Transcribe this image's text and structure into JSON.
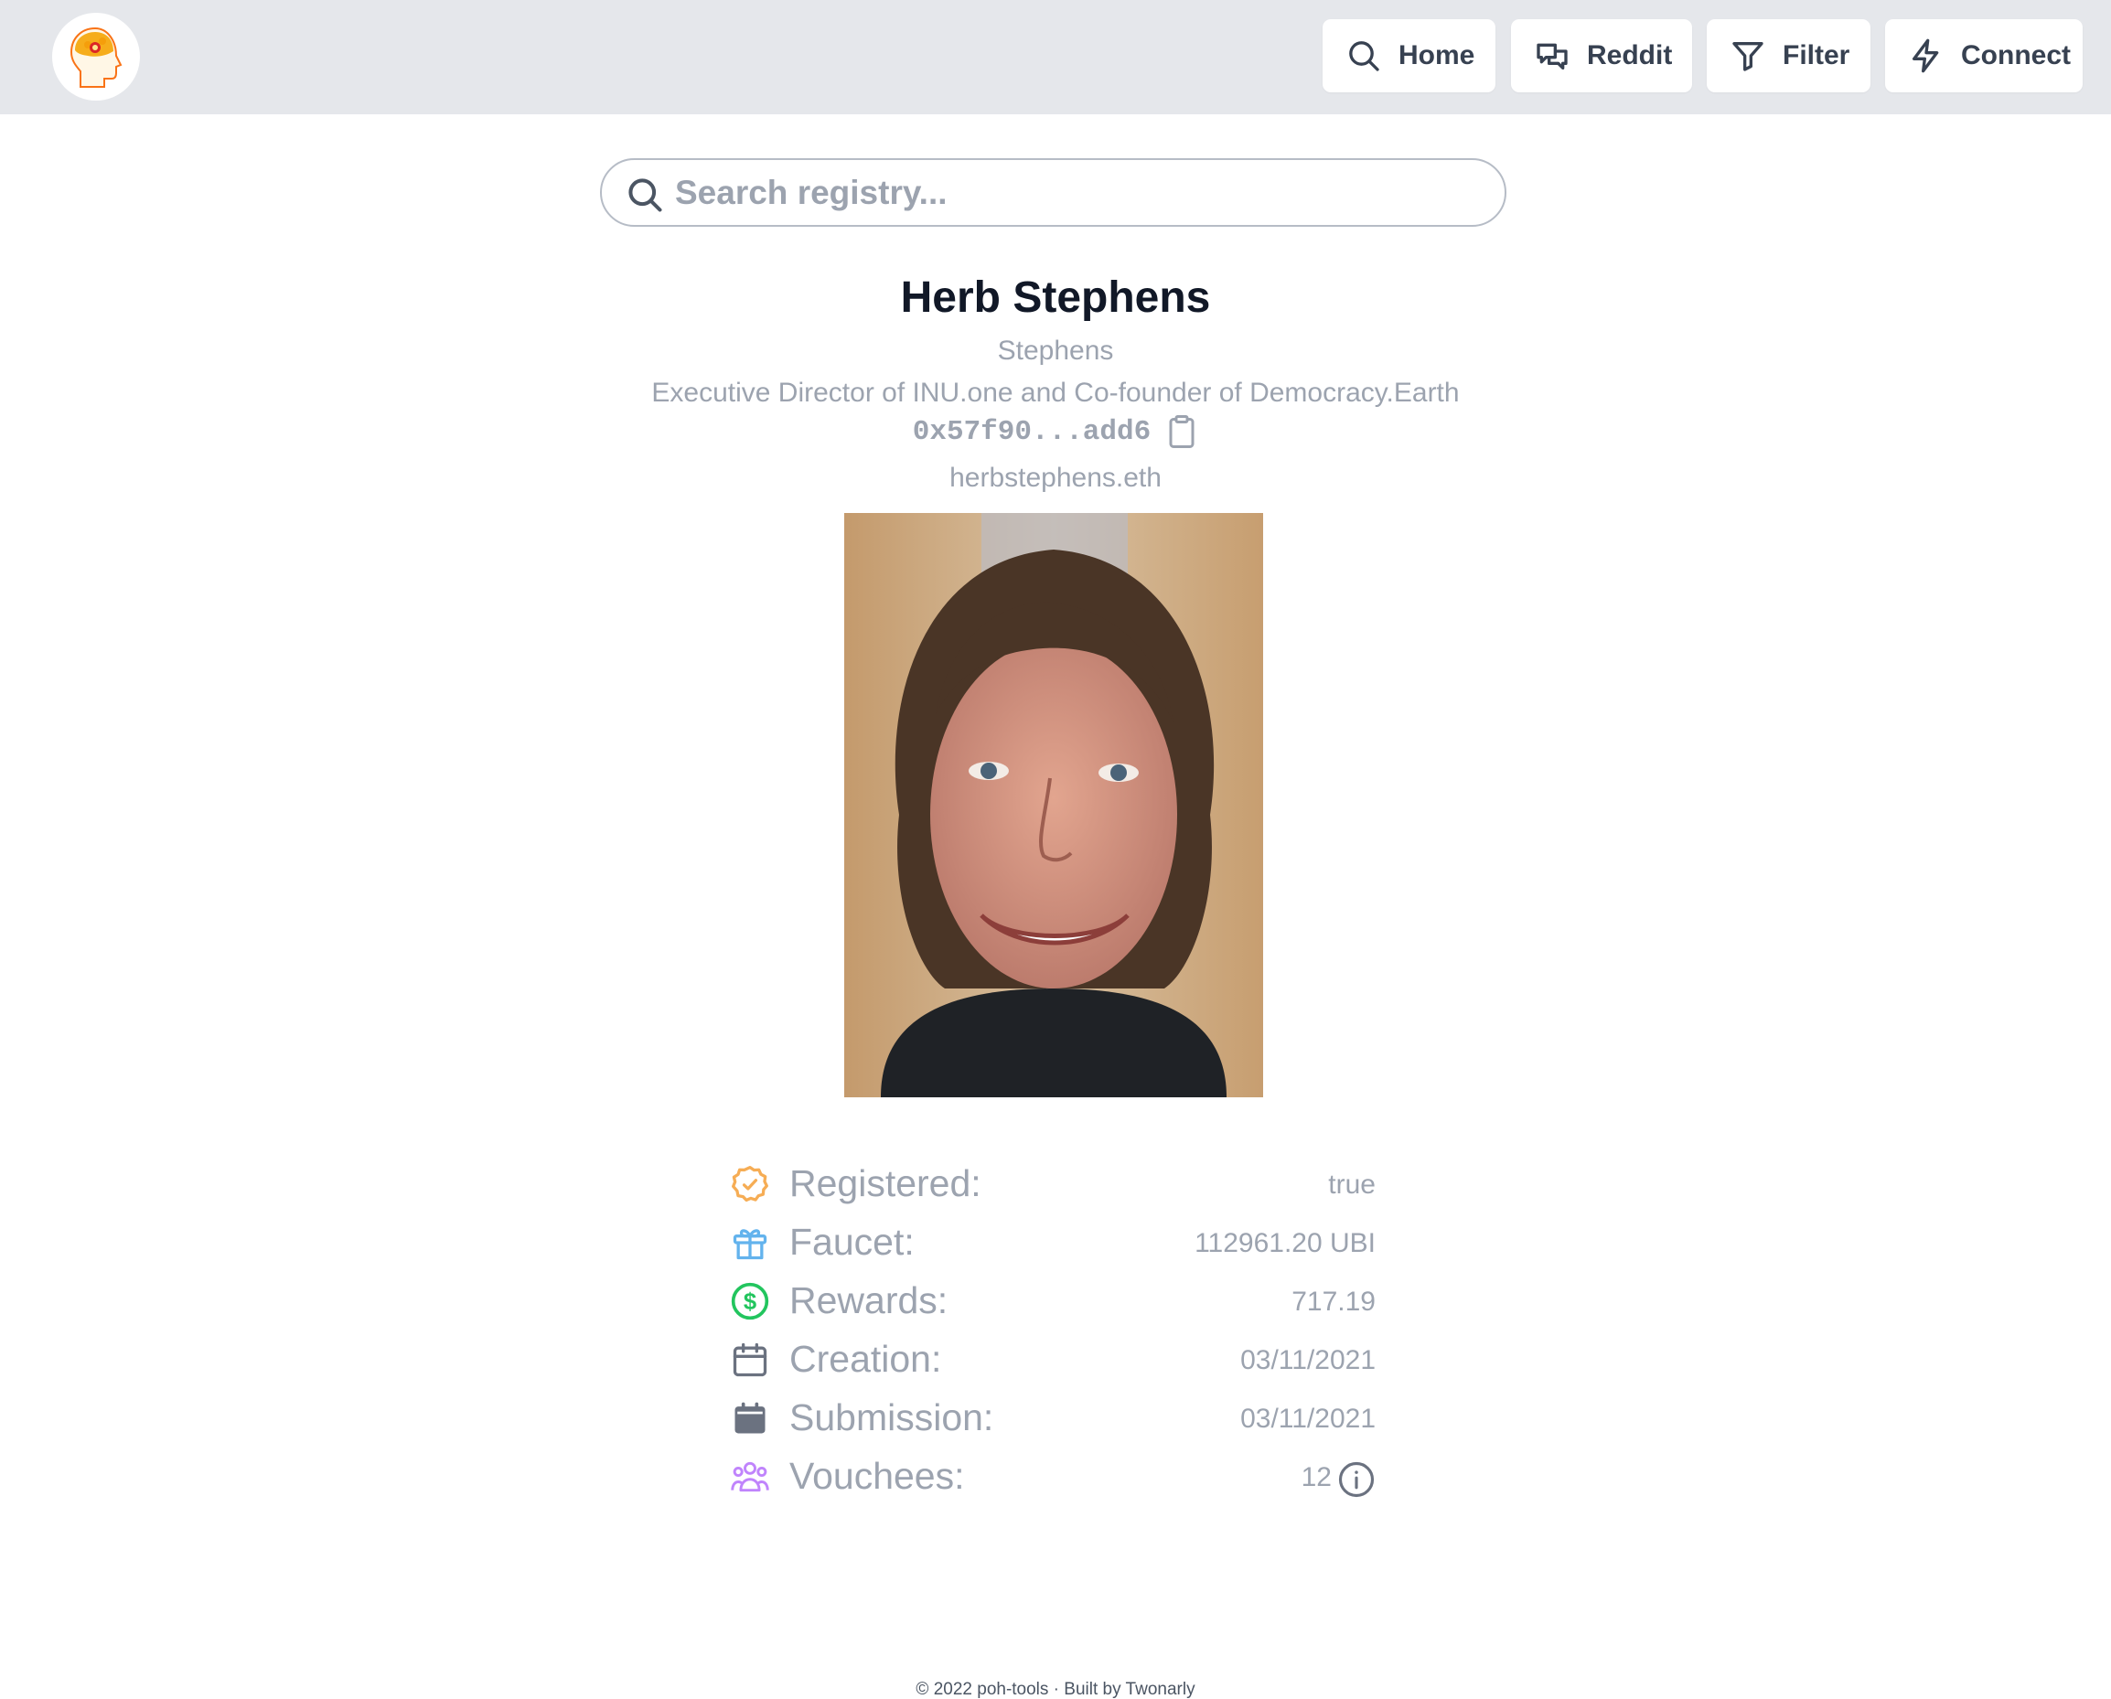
{
  "nav": {
    "home_label": "Home",
    "reddit_label": "Reddit",
    "filter_label": "Filter",
    "connect_label": "Connect"
  },
  "search": {
    "placeholder": "Search registry..."
  },
  "profile": {
    "name": "Herb Stephens",
    "nickname": "Stephens",
    "bio": "Executive Director of INU.one and Co-founder of Democracy.Earth",
    "address": "0x57f90...add6",
    "ens": "herbstephens.eth"
  },
  "stats": [
    {
      "label": "Registered:",
      "value": "true",
      "icon": "badge-check-icon",
      "color": "#f6ad55"
    },
    {
      "label": "Faucet:",
      "value": "112961.20 UBI",
      "icon": "gift-icon",
      "color": "#63b3ed"
    },
    {
      "label": "Rewards:",
      "value": "717.19",
      "icon": "dollar-icon",
      "color": "#22c55e"
    },
    {
      "label": "Creation:",
      "value": "03/11/2021",
      "icon": "calendar-outline-icon",
      "color": "#6b7280"
    },
    {
      "label": "Submission:",
      "value": "03/11/2021",
      "icon": "calendar-solid-icon",
      "color": "#6b7280"
    },
    {
      "label": "Vouchees:",
      "value": "12",
      "icon": "user-group-icon",
      "color": "#c084fc"
    }
  ],
  "footer": {
    "text": "© 2022 poh-tools · Built by Twonarly"
  }
}
